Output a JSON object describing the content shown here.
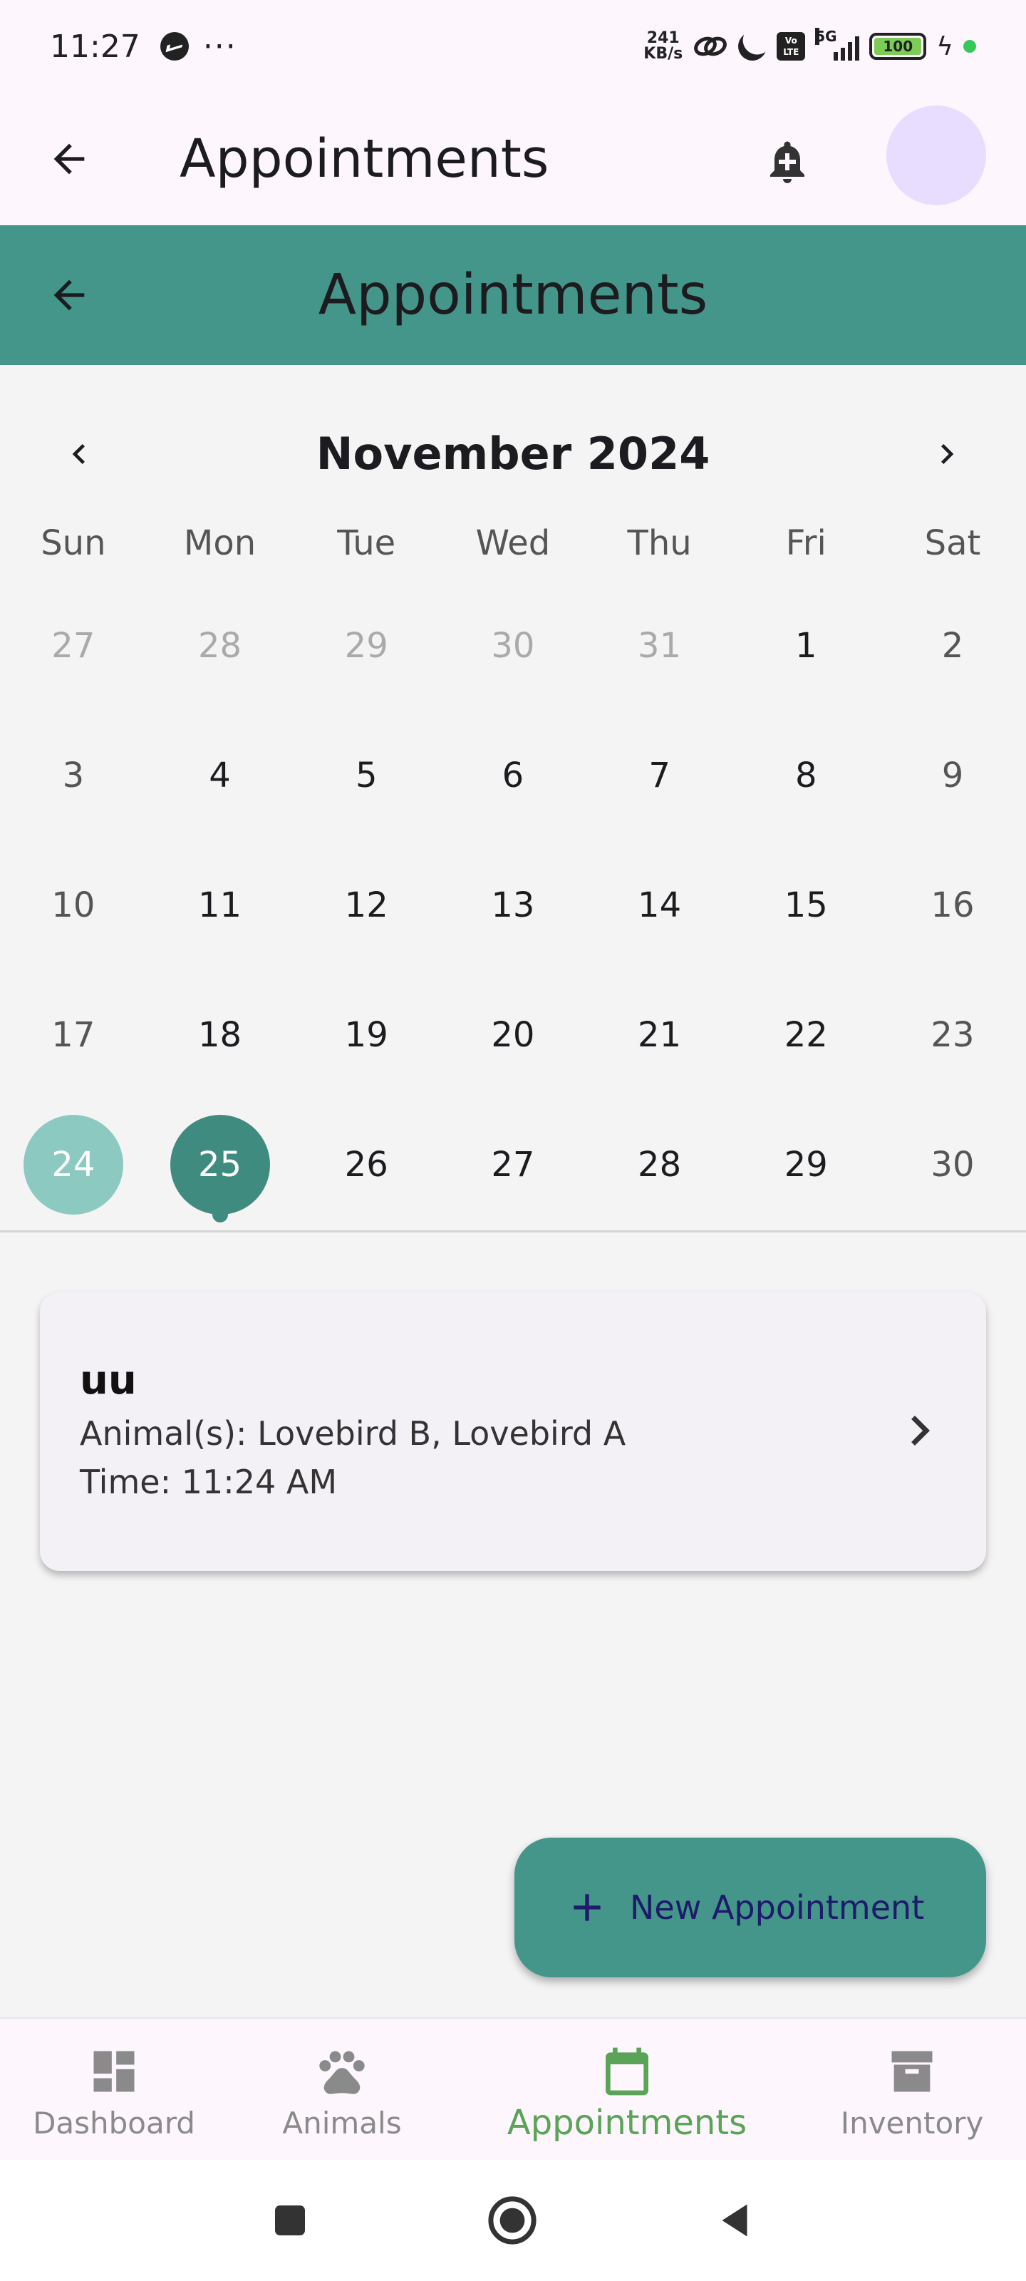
{
  "status_bar": {
    "time": "11:27",
    "dots": "···",
    "speed_value": "241",
    "speed_unit": "KB/s",
    "volte": "Vo LTE",
    "network": "5G",
    "battery": "100"
  },
  "app_bar": {
    "title": "Appointments"
  },
  "section_header": {
    "title": "Appointments"
  },
  "calendar": {
    "month_title": "November 2024",
    "weekdays": [
      "Sun",
      "Mon",
      "Tue",
      "Wed",
      "Thu",
      "Fri",
      "Sat"
    ],
    "days": [
      "27",
      "28",
      "29",
      "30",
      "31",
      "1",
      "2",
      "3",
      "4",
      "5",
      "6",
      "7",
      "8",
      "9",
      "10",
      "11",
      "12",
      "13",
      "14",
      "15",
      "16",
      "17",
      "18",
      "19",
      "20",
      "21",
      "22",
      "23",
      "24",
      "25",
      "26",
      "27",
      "28",
      "29",
      "30"
    ],
    "today": "24",
    "selected": "25"
  },
  "appointment": {
    "title": "uu",
    "animals": "Animal(s): Lovebird B, Lovebird A",
    "time": "Time: 11:24 AM"
  },
  "fab": {
    "label": "New Appointment"
  },
  "bottom_nav": {
    "items": [
      {
        "label": "Dashboard",
        "icon": "dashboard-icon"
      },
      {
        "label": "Animals",
        "icon": "paw-icon"
      },
      {
        "label": "Appointments",
        "icon": "calendar-icon"
      },
      {
        "label": "Inventory",
        "icon": "archive-icon"
      }
    ],
    "active": "Appointments"
  },
  "colors": {
    "primary": "#45968a",
    "selected_day": "#3f8b80",
    "today_day": "#8cc9c0",
    "active_nav": "#5aa357",
    "avatar": "#e9ddff"
  }
}
